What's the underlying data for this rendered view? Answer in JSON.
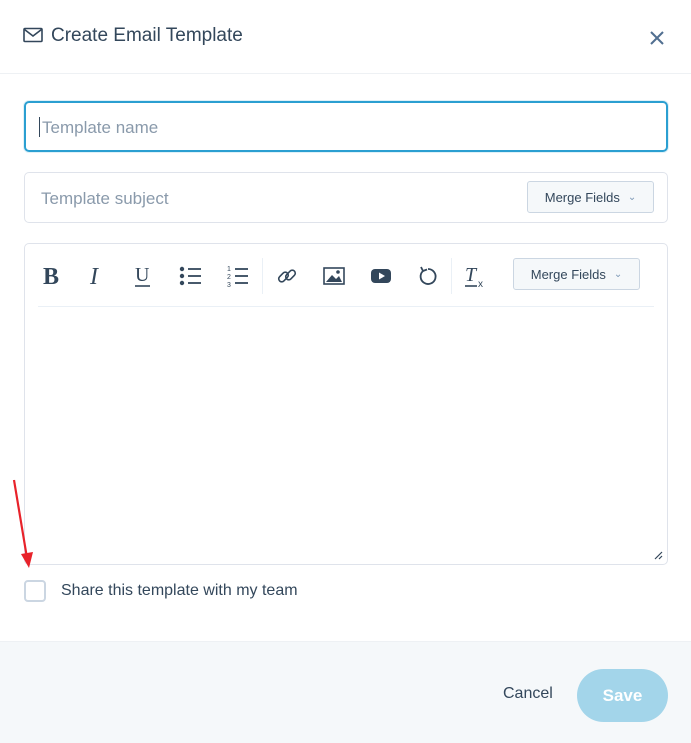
{
  "dialog": {
    "title": "Create Email Template",
    "title_icon": "mail-icon",
    "close_icon": "close-icon"
  },
  "form": {
    "name": {
      "value": "",
      "placeholder": "Template name"
    },
    "subject": {
      "value": "",
      "placeholder": "Template subject"
    },
    "subject_merge_fields_label": "Merge Fields",
    "editor_merge_fields_label": "Merge Fields",
    "toolbar_icons": [
      "bold-icon",
      "italic-icon",
      "underline-icon",
      "bulleted-list-icon",
      "numbered-list-icon",
      "link-icon",
      "image-icon",
      "video-icon",
      "undo-icon",
      "clear-formatting-icon"
    ],
    "share_label": "Share this template with my team",
    "share_checked": false
  },
  "footer": {
    "cancel_label": "Cancel",
    "save_label": "Save"
  },
  "colors": {
    "accent": "#2b9fd1",
    "save_disabled": "#a3d5ea",
    "annotation_arrow": "#e8222a"
  }
}
